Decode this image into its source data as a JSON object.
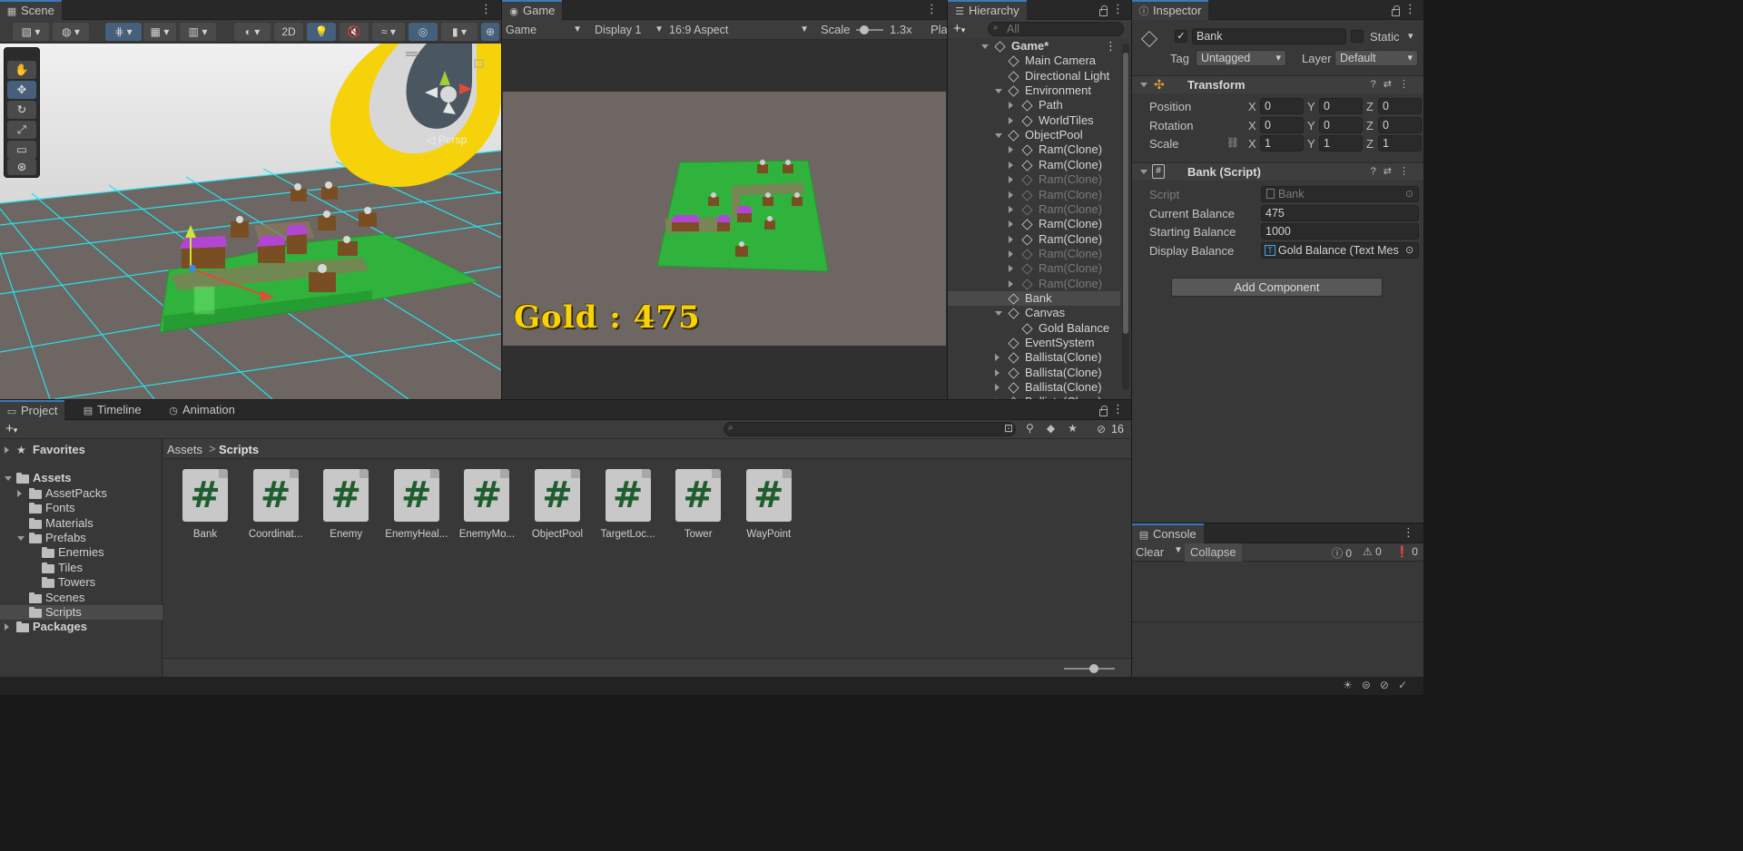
{
  "scene": {
    "tab_label": "Scene",
    "toolbar": {
      "mode_2d": "2D"
    },
    "persp_label": "Persp"
  },
  "game": {
    "tab_label": "Game",
    "game_dropdown": "Game",
    "display_dropdown": "Display 1",
    "aspect_dropdown": "16:9 Aspect",
    "scale_label": "Scale",
    "scale_value": "1.3x",
    "play_label": "Pla",
    "gold_text": "Gold : 475"
  },
  "hierarchy": {
    "tab_label": "Hierarchy",
    "search_placeholder": "All",
    "items": [
      {
        "label": "Game*",
        "depth": 0,
        "expand": "open",
        "root": true,
        "dim": false,
        "selected": false
      },
      {
        "label": "Main Camera",
        "depth": 1,
        "expand": "none",
        "dim": false,
        "selected": false
      },
      {
        "label": "Directional Light",
        "depth": 1,
        "expand": "none",
        "dim": false,
        "selected": false
      },
      {
        "label": "Environment",
        "depth": 1,
        "expand": "open",
        "dim": false,
        "selected": false
      },
      {
        "label": "Path",
        "depth": 2,
        "expand": "closed",
        "dim": false,
        "selected": false
      },
      {
        "label": "WorldTiles",
        "depth": 2,
        "expand": "closed",
        "dim": false,
        "selected": false
      },
      {
        "label": "ObjectPool",
        "depth": 1,
        "expand": "open",
        "dim": false,
        "selected": false
      },
      {
        "label": "Ram(Clone)",
        "depth": 2,
        "expand": "closed",
        "dim": false,
        "selected": false
      },
      {
        "label": "Ram(Clone)",
        "depth": 2,
        "expand": "closed",
        "dim": false,
        "selected": false
      },
      {
        "label": "Ram(Clone)",
        "depth": 2,
        "expand": "closed",
        "dim": true,
        "selected": false
      },
      {
        "label": "Ram(Clone)",
        "depth": 2,
        "expand": "closed",
        "dim": true,
        "selected": false
      },
      {
        "label": "Ram(Clone)",
        "depth": 2,
        "expand": "closed",
        "dim": true,
        "selected": false
      },
      {
        "label": "Ram(Clone)",
        "depth": 2,
        "expand": "closed",
        "dim": false,
        "selected": false
      },
      {
        "label": "Ram(Clone)",
        "depth": 2,
        "expand": "closed",
        "dim": false,
        "selected": false
      },
      {
        "label": "Ram(Clone)",
        "depth": 2,
        "expand": "closed",
        "dim": true,
        "selected": false
      },
      {
        "label": "Ram(Clone)",
        "depth": 2,
        "expand": "closed",
        "dim": true,
        "selected": false
      },
      {
        "label": "Ram(Clone)",
        "depth": 2,
        "expand": "closed",
        "dim": true,
        "selected": false
      },
      {
        "label": "Bank",
        "depth": 1,
        "expand": "none",
        "dim": false,
        "selected": true
      },
      {
        "label": "Canvas",
        "depth": 1,
        "expand": "open",
        "dim": false,
        "selected": false
      },
      {
        "label": "Gold Balance",
        "depth": 2,
        "expand": "none",
        "dim": false,
        "selected": false
      },
      {
        "label": "EventSystem",
        "depth": 1,
        "expand": "none",
        "dim": false,
        "selected": false
      },
      {
        "label": "Ballista(Clone)",
        "depth": 1,
        "expand": "closed",
        "dim": false,
        "selected": false
      },
      {
        "label": "Ballista(Clone)",
        "depth": 1,
        "expand": "closed",
        "dim": false,
        "selected": false
      },
      {
        "label": "Ballista(Clone)",
        "depth": 1,
        "expand": "closed",
        "dim": false,
        "selected": false
      },
      {
        "label": "Ballista(Clone)",
        "depth": 1,
        "expand": "closed",
        "dim": false,
        "selected": false
      }
    ]
  },
  "inspector": {
    "tab_label": "Inspector",
    "object_name": "Bank",
    "static_label": "Static",
    "tag_label": "Tag",
    "tag_value": "Untagged",
    "layer_label": "Layer",
    "layer_value": "Default",
    "transform": {
      "title": "Transform",
      "rows": [
        {
          "label": "Position",
          "x": "0",
          "y": "0",
          "z": "0"
        },
        {
          "label": "Rotation",
          "x": "0",
          "y": "0",
          "z": "0"
        },
        {
          "label": "Scale",
          "x": "1",
          "y": "1",
          "z": "1"
        }
      ]
    },
    "bank_script": {
      "title": "Bank (Script)",
      "script_label": "Script",
      "script_value": "Bank",
      "current_balance_label": "Current Balance",
      "current_balance_value": "475",
      "starting_balance_label": "Starting Balance",
      "starting_balance_value": "1000",
      "display_balance_label": "Display Balance",
      "display_balance_value": "Gold Balance (Text Mes"
    },
    "add_component_label": "Add Component"
  },
  "project": {
    "tabs": [
      "Project",
      "Timeline",
      "Animation"
    ],
    "hidden_count": "16",
    "tree": [
      {
        "label": "Favorites",
        "depth": 0,
        "expand": "closed",
        "bold": true,
        "icon": "star",
        "selected": false
      },
      {
        "label": "Assets",
        "depth": 0,
        "expand": "open",
        "bold": true,
        "icon": "folder",
        "selected": false
      },
      {
        "label": "AssetPacks",
        "depth": 1,
        "expand": "closed",
        "icon": "folder",
        "selected": false
      },
      {
        "label": "Fonts",
        "depth": 1,
        "expand": "none",
        "icon": "folder",
        "selected": false
      },
      {
        "label": "Materials",
        "depth": 1,
        "expand": "none",
        "icon": "folder",
        "selected": false
      },
      {
        "label": "Prefabs",
        "depth": 1,
        "expand": "open",
        "icon": "folder",
        "selected": false
      },
      {
        "label": "Enemies",
        "depth": 2,
        "expand": "none",
        "icon": "folder",
        "selected": false
      },
      {
        "label": "Tiles",
        "depth": 2,
        "expand": "none",
        "icon": "folder",
        "selected": false
      },
      {
        "label": "Towers",
        "depth": 2,
        "expand": "none",
        "icon": "folder",
        "selected": false
      },
      {
        "label": "Scenes",
        "depth": 1,
        "expand": "none",
        "icon": "folder",
        "selected": false
      },
      {
        "label": "Scripts",
        "depth": 1,
        "expand": "none",
        "icon": "folder",
        "selected": true
      },
      {
        "label": "Packages",
        "depth": 0,
        "expand": "closed",
        "bold": true,
        "icon": "folder",
        "selected": false
      }
    ],
    "breadcrumb": [
      "Assets",
      "Scripts"
    ],
    "assets": [
      "Bank",
      "Coordinat...",
      "Enemy",
      "EnemyHeal...",
      "EnemyMo...",
      "ObjectPool",
      "TargetLoc...",
      "Tower",
      "WayPoint"
    ]
  },
  "console": {
    "tab_label": "Console",
    "clear_label": "Clear",
    "collapse_label": "Collapse",
    "info_count": "0",
    "warning_count": "0",
    "error_count": "0"
  },
  "colors": {
    "accent_blue": "#3a79bb",
    "gold_text": "#f6d20a",
    "grid_cyan": "#22e3ee",
    "ground_green": "#2fb33c"
  }
}
